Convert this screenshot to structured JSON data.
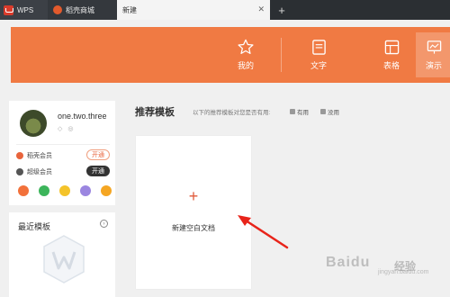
{
  "tabs": [
    {
      "label": "WPS"
    },
    {
      "label": "稻壳商城"
    },
    {
      "label": "新建"
    }
  ],
  "banner": {
    "items": [
      {
        "label": "我的",
        "icon": "star-icon"
      },
      {
        "label": "文字",
        "icon": "document-icon"
      },
      {
        "label": "表格",
        "icon": "table-icon"
      },
      {
        "label": "演示",
        "icon": "presentation-icon"
      }
    ],
    "accent": "#f07a43"
  },
  "profile": {
    "username": "one.two.three",
    "member1": {
      "label": "稻壳会员",
      "action": "开通"
    },
    "member2": {
      "label": "超级会员",
      "action": "开通"
    }
  },
  "recent": {
    "title": "最近模板"
  },
  "main": {
    "section_title": "推荐模板",
    "hint": "以下的推荐模板对您是否有用:",
    "useful": "有用",
    "useless": "没用",
    "new_blank_label": "新建空白文档",
    "plus": "+"
  },
  "watermark": {
    "text": "Baidu",
    "cn": "经验",
    "sub": "jingyan.baidu.com"
  }
}
